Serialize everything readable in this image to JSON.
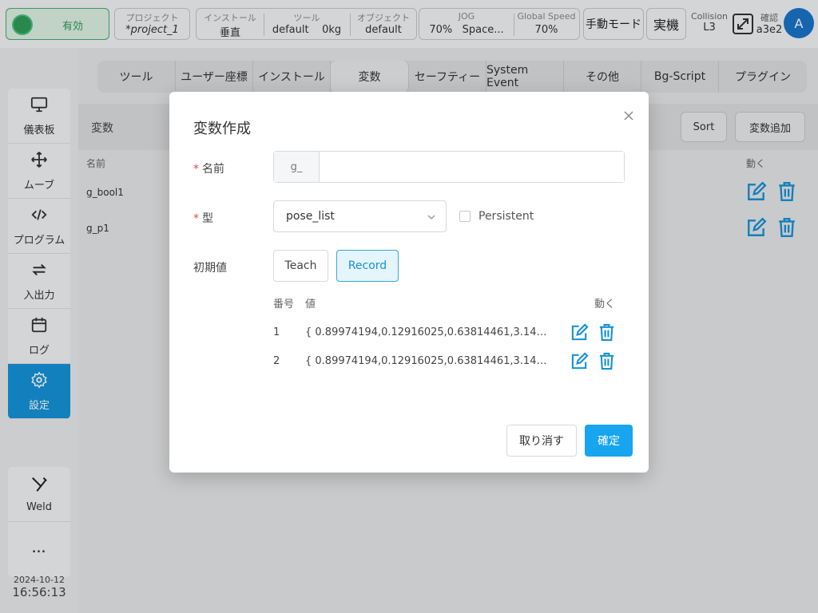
{
  "topbar": {
    "enable_label": "有効",
    "project_label": "プロジェクト",
    "project_value": "*project_1",
    "install_label": "インストール",
    "install_value": "垂直",
    "tool_label": "ツール",
    "tool_value": "default",
    "tool_weight": "0kg",
    "object_label": "オブジェクト",
    "object_value": "default",
    "jog_label": "JOG",
    "jog_percent": "70%",
    "jog_space": "Space...",
    "speed_label": "Global Speed",
    "speed_value": "70%",
    "manual_mode": "手動モード",
    "real_robot": "実機",
    "collision_label": "Collision",
    "collision_value": "L3",
    "confirm_label": "確認",
    "confirm_value": "a3e2",
    "avatar_letter": "A"
  },
  "nav": {
    "items": [
      {
        "label": "儀表板",
        "icon": "monitor-icon"
      },
      {
        "label": "ムーブ",
        "icon": "move-icon"
      },
      {
        "label": "プログラム",
        "icon": "code-icon"
      },
      {
        "label": "入出力",
        "icon": "io-icon"
      },
      {
        "label": "ログ",
        "icon": "calendar-icon"
      },
      {
        "label": "設定",
        "icon": "gear-icon"
      }
    ],
    "weld_label": "Weld",
    "more_label": "..."
  },
  "datetime": {
    "date": "2024-10-12",
    "time": "16:56:13"
  },
  "tabs": [
    "ツール",
    "ユーザー座標",
    "インストール",
    "変数",
    "セーフティー",
    "System Event",
    "その他",
    "Bg-Script",
    "プラグイン"
  ],
  "active_tab": "変数",
  "variables": {
    "title": "変数",
    "sort_label": "Sort",
    "add_label": "変数追加",
    "col_name": "名前",
    "col_action": "動く",
    "rows": [
      "g_bool1",
      "g_p1"
    ]
  },
  "dialog": {
    "title": "変数作成",
    "name_label": "名前",
    "name_prefix": "g_",
    "name_value": "",
    "type_label": "型",
    "type_value": "pose_list",
    "persistent_label": "Persistent",
    "init_label": "初期値",
    "teach_label": "Teach",
    "record_label": "Record",
    "col_no": "番号",
    "col_value": "値",
    "col_action": "動く",
    "rows": [
      {
        "no": "1",
        "value": "{ 0.89974194,0.12916025,0.63814461,3.14152..."
      },
      {
        "no": "2",
        "value": "{ 0.89974194,0.12916025,0.63814461,3.14152..."
      }
    ],
    "cancel_label": "取り消す",
    "ok_label": "確定"
  },
  "colors": {
    "accent": "#1592d6",
    "primary_button": "#17a5ef",
    "enable_green": "#2e9b58",
    "required": "#e04b4b"
  }
}
